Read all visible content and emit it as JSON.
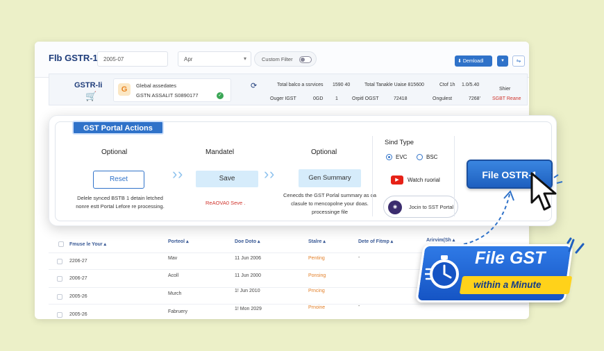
{
  "topbar": {
    "title": "Fl‍b GSTR-1",
    "year": "2005-07",
    "month": "Apr",
    "custom_filter": "Custom Filter",
    "download_label": "Demloadl",
    "caret": "▾",
    "settings_glyph": "⇋"
  },
  "gstr_row": {
    "label": "GSTR-li",
    "company_initial": "G",
    "company_name": "Glebal assedates",
    "company_gstin": "GSTN ASSALIT S0890177",
    "stats": {
      "total_sales_label": "Total balco a ssrvices",
      "total_sales_value": "1590 40",
      "total_taxable_label": "Total Tanakle Uaise 815600",
      "igst_label": "Ctof 1h",
      "igst_value": "1.0/5.40",
      "status_label": "Shier",
      "ouger_label": "Ouger IGST",
      "ouger_value": "0GD",
      "ouger_extra": "1",
      "orpitl_label": "Orpitl OGST",
      "orpitl_value": "72418",
      "ongul_label": "Ongulest",
      "ongul_value": "7268'",
      "status_value": "SGBT Reane"
    }
  },
  "actions": {
    "title": "GST Portal Actions",
    "steps": [
      {
        "label": "Optional",
        "button": "Reset",
        "desc_line1": "Delele synced BSTB 1 detain letched",
        "desc_line2": "nonre estt Portal Lefore re processing."
      },
      {
        "label": "Mandatel",
        "button": "Save",
        "desc_line1": "ReAOVA0 Seve ."
      },
      {
        "label": "Optional",
        "button": "Gen Summary",
        "desc_line1": "Cenecds the GST Porlal summary as oa",
        "desc_line2": "clasule to mencopolne your doas.",
        "desc_line3": "processinge file"
      }
    ],
    "sind": {
      "title": "Sind Type",
      "opt1": "EVC",
      "opt2": "BSC",
      "watch": "Watch ruorial",
      "portal": "Jocin to SST Portal"
    },
    "file_button": "File OSTR-1"
  },
  "table": {
    "headers": [
      "Fmuse le Your",
      "Porteol",
      "Doe Doto",
      "Stalre",
      "Dete of Fitmp",
      "Arirvim(Sh"
    ],
    "rows": [
      {
        "year": "2206-27",
        "period": "Mav",
        "date": "11 Jun 2006",
        "status": "Penting",
        "filed": "-"
      },
      {
        "year": "2006-27",
        "period": "Acoll",
        "date": "11 Jun 2000",
        "status": "Ponsing",
        "filed": ""
      },
      {
        "year": "2005-26",
        "period": "Murch",
        "date": "1! Jun 2010",
        "status": "Prncing",
        "filed": ""
      },
      {
        "year": "2005-26",
        "period": "Fabruery",
        "date": "1! Mon 2029",
        "status": "Prnoine",
        "filed": "-"
      }
    ]
  },
  "promo": {
    "title": "File GST",
    "subtitle": "within a Minute"
  },
  "colors": {
    "accent": "#2f72c9",
    "background": "#ecf0c8",
    "pending": "#e3802a",
    "promo_yellow": "#ffd21a"
  }
}
